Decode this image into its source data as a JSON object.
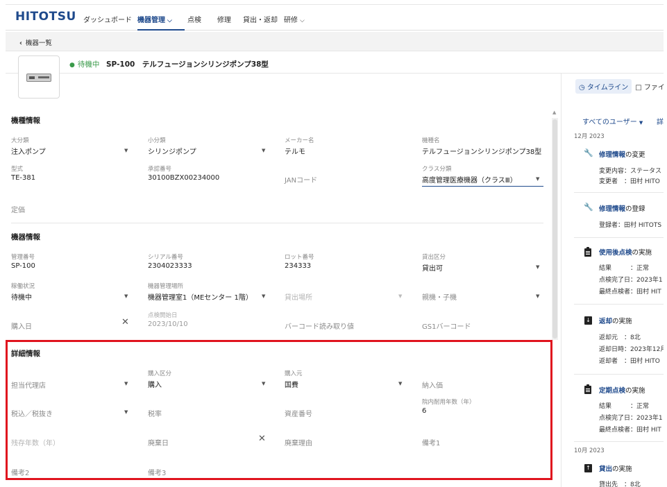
{
  "nav": {
    "logo": "HITOTSU",
    "items": [
      {
        "label": "ダッシュボード",
        "active": false,
        "chevron": false
      },
      {
        "label": "機器管理",
        "active": true,
        "chevron": true
      },
      {
        "label": "点検",
        "active": false,
        "chevron": false
      },
      {
        "label": "修理",
        "active": false,
        "chevron": false
      },
      {
        "label": "貸出・返却",
        "active": false,
        "chevron": false
      },
      {
        "label": "研修",
        "active": false,
        "chevron": true
      }
    ]
  },
  "subbar": {
    "back_label": "機器一覧"
  },
  "device": {
    "status": "待機中",
    "title": "SP-100　テルフュージョンシリンジポンプ38型"
  },
  "sections": {
    "model_info": "機種情報",
    "device_info": "機器情報",
    "detail_info": "詳細情報"
  },
  "model_info": {
    "major_category": {
      "label": "大分類",
      "value": "注入ポンプ"
    },
    "minor_category": {
      "label": "小分類",
      "value": "シリンジポンプ"
    },
    "maker": {
      "label": "メーカー名",
      "value": "テルモ"
    },
    "model_name": {
      "label": "機種名",
      "value": "テルフュージョンシリンジポンプ38型"
    },
    "model_type": {
      "label": "型式",
      "value": "TE-381"
    },
    "approval_no": {
      "label": "承認番号",
      "value": "30100BZX00234000"
    },
    "jan_code": {
      "placeholder": "JANコード"
    },
    "class": {
      "label": "クラス分類",
      "value": "高度管理医療機器（クラスⅢ）"
    },
    "price": {
      "placeholder": "定価"
    }
  },
  "device_info": {
    "control_no": {
      "label": "管理番号",
      "value": "SP-100"
    },
    "serial_no": {
      "label": "シリアル番号",
      "value": "2304023333"
    },
    "lot_no": {
      "label": "ロット番号",
      "value": "234333"
    },
    "rental_type": {
      "label": "貸出区分",
      "value": "貸出可"
    },
    "operation_status": {
      "label": "稼働状況",
      "value": "待機中"
    },
    "location": {
      "label": "機器管理場所",
      "value": "機器管理室1（MEセンター 1階）"
    },
    "rental_place": {
      "placeholder": "貸出場所"
    },
    "parent_child": {
      "placeholder": "親機・子機"
    },
    "purchase_date": {
      "placeholder": "購入日"
    },
    "inspection_start": {
      "label": "点検開始日",
      "value": "2023/10/10"
    },
    "barcode": {
      "placeholder": "バーコード読み取り値"
    },
    "gs1_barcode": {
      "placeholder": "GS1バーコード"
    }
  },
  "detail_info": {
    "agent": {
      "placeholder": "担当代理店"
    },
    "purchase_type": {
      "label": "購入区分",
      "value": "購入"
    },
    "purchase_source": {
      "label": "購入元",
      "value": "国費"
    },
    "delivery_price": {
      "placeholder": "納入価"
    },
    "tax_type": {
      "placeholder": "税込／税抜き"
    },
    "tax_rate": {
      "placeholder": "税率"
    },
    "asset_no": {
      "placeholder": "資産番号"
    },
    "useful_life": {
      "label": "院内耐用年数（年）",
      "value": "6"
    },
    "remaining_years": {
      "placeholder": "残存年数（年）"
    },
    "disposal_date": {
      "placeholder": "廃棄日"
    },
    "disposal_reason": {
      "placeholder": "廃棄理由"
    },
    "note1": {
      "placeholder": "備考1"
    },
    "note2": {
      "placeholder": "備考2"
    },
    "note3": {
      "placeholder": "備考3"
    }
  },
  "timeline": {
    "tab_timeline": "タイムライン",
    "tab_files": "ファイル",
    "filter_label": "すべてのユーザー",
    "detail_label": "詳",
    "month_dec": "12月 2023",
    "month_oct": "10月 2023",
    "events": [
      {
        "title_bold": "修理情報",
        "title_rest": "の変更",
        "line1": "変更内容：ステータス",
        "line2": "変更者　：田村 HITO"
      },
      {
        "title_bold": "修理情報",
        "title_rest": "の登録",
        "line1": "登録者：田村 HITOTS",
        "line2": ""
      },
      {
        "title_bold": "使用後点検",
        "title_rest": "の実施",
        "line1": "結果　　　：正常",
        "line2": "点検完了日：2023年1",
        "line3": "最終点検者：田村 HIT"
      },
      {
        "title_bold": "返却",
        "title_rest": "の実施",
        "line1": "返却元　：8北",
        "line2": "返却日時：2023年12月",
        "line3": "返却者　：田村 HITO"
      },
      {
        "title_bold": "定期点検",
        "title_rest": "の実施",
        "line1": "結果　　　：正常",
        "line2": "点検完了日：2023年1",
        "line3": "最終点検者：田村 HIT"
      },
      {
        "title_bold": "貸出",
        "title_rest": "の実施",
        "line1": "貸出先　：8北"
      }
    ]
  }
}
